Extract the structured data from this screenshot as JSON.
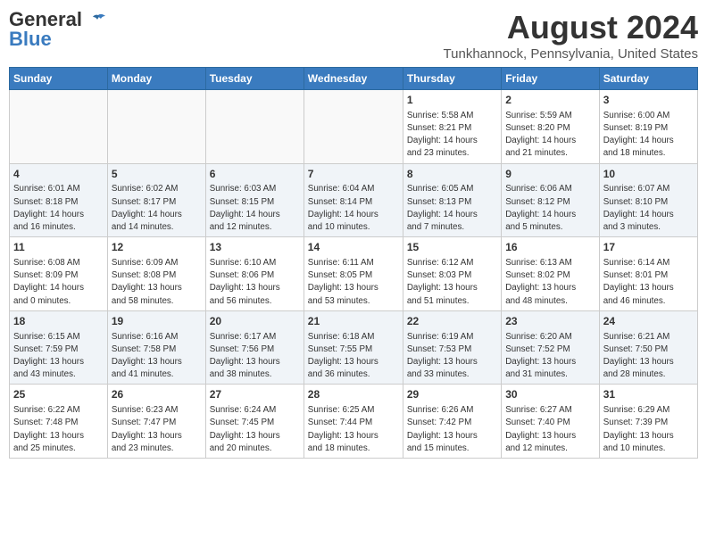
{
  "header": {
    "logo_line1": "General",
    "logo_line2": "Blue",
    "month_year": "August 2024",
    "location": "Tunkhannock, Pennsylvania, United States"
  },
  "days_of_week": [
    "Sunday",
    "Monday",
    "Tuesday",
    "Wednesday",
    "Thursday",
    "Friday",
    "Saturday"
  ],
  "weeks": [
    [
      {
        "day": "",
        "text": ""
      },
      {
        "day": "",
        "text": ""
      },
      {
        "day": "",
        "text": ""
      },
      {
        "day": "",
        "text": ""
      },
      {
        "day": "1",
        "text": "Sunrise: 5:58 AM\nSunset: 8:21 PM\nDaylight: 14 hours\nand 23 minutes."
      },
      {
        "day": "2",
        "text": "Sunrise: 5:59 AM\nSunset: 8:20 PM\nDaylight: 14 hours\nand 21 minutes."
      },
      {
        "day": "3",
        "text": "Sunrise: 6:00 AM\nSunset: 8:19 PM\nDaylight: 14 hours\nand 18 minutes."
      }
    ],
    [
      {
        "day": "4",
        "text": "Sunrise: 6:01 AM\nSunset: 8:18 PM\nDaylight: 14 hours\nand 16 minutes."
      },
      {
        "day": "5",
        "text": "Sunrise: 6:02 AM\nSunset: 8:17 PM\nDaylight: 14 hours\nand 14 minutes."
      },
      {
        "day": "6",
        "text": "Sunrise: 6:03 AM\nSunset: 8:15 PM\nDaylight: 14 hours\nand 12 minutes."
      },
      {
        "day": "7",
        "text": "Sunrise: 6:04 AM\nSunset: 8:14 PM\nDaylight: 14 hours\nand 10 minutes."
      },
      {
        "day": "8",
        "text": "Sunrise: 6:05 AM\nSunset: 8:13 PM\nDaylight: 14 hours\nand 7 minutes."
      },
      {
        "day": "9",
        "text": "Sunrise: 6:06 AM\nSunset: 8:12 PM\nDaylight: 14 hours\nand 5 minutes."
      },
      {
        "day": "10",
        "text": "Sunrise: 6:07 AM\nSunset: 8:10 PM\nDaylight: 14 hours\nand 3 minutes."
      }
    ],
    [
      {
        "day": "11",
        "text": "Sunrise: 6:08 AM\nSunset: 8:09 PM\nDaylight: 14 hours\nand 0 minutes."
      },
      {
        "day": "12",
        "text": "Sunrise: 6:09 AM\nSunset: 8:08 PM\nDaylight: 13 hours\nand 58 minutes."
      },
      {
        "day": "13",
        "text": "Sunrise: 6:10 AM\nSunset: 8:06 PM\nDaylight: 13 hours\nand 56 minutes."
      },
      {
        "day": "14",
        "text": "Sunrise: 6:11 AM\nSunset: 8:05 PM\nDaylight: 13 hours\nand 53 minutes."
      },
      {
        "day": "15",
        "text": "Sunrise: 6:12 AM\nSunset: 8:03 PM\nDaylight: 13 hours\nand 51 minutes."
      },
      {
        "day": "16",
        "text": "Sunrise: 6:13 AM\nSunset: 8:02 PM\nDaylight: 13 hours\nand 48 minutes."
      },
      {
        "day": "17",
        "text": "Sunrise: 6:14 AM\nSunset: 8:01 PM\nDaylight: 13 hours\nand 46 minutes."
      }
    ],
    [
      {
        "day": "18",
        "text": "Sunrise: 6:15 AM\nSunset: 7:59 PM\nDaylight: 13 hours\nand 43 minutes."
      },
      {
        "day": "19",
        "text": "Sunrise: 6:16 AM\nSunset: 7:58 PM\nDaylight: 13 hours\nand 41 minutes."
      },
      {
        "day": "20",
        "text": "Sunrise: 6:17 AM\nSunset: 7:56 PM\nDaylight: 13 hours\nand 38 minutes."
      },
      {
        "day": "21",
        "text": "Sunrise: 6:18 AM\nSunset: 7:55 PM\nDaylight: 13 hours\nand 36 minutes."
      },
      {
        "day": "22",
        "text": "Sunrise: 6:19 AM\nSunset: 7:53 PM\nDaylight: 13 hours\nand 33 minutes."
      },
      {
        "day": "23",
        "text": "Sunrise: 6:20 AM\nSunset: 7:52 PM\nDaylight: 13 hours\nand 31 minutes."
      },
      {
        "day": "24",
        "text": "Sunrise: 6:21 AM\nSunset: 7:50 PM\nDaylight: 13 hours\nand 28 minutes."
      }
    ],
    [
      {
        "day": "25",
        "text": "Sunrise: 6:22 AM\nSunset: 7:48 PM\nDaylight: 13 hours\nand 25 minutes."
      },
      {
        "day": "26",
        "text": "Sunrise: 6:23 AM\nSunset: 7:47 PM\nDaylight: 13 hours\nand 23 minutes."
      },
      {
        "day": "27",
        "text": "Sunrise: 6:24 AM\nSunset: 7:45 PM\nDaylight: 13 hours\nand 20 minutes."
      },
      {
        "day": "28",
        "text": "Sunrise: 6:25 AM\nSunset: 7:44 PM\nDaylight: 13 hours\nand 18 minutes."
      },
      {
        "day": "29",
        "text": "Sunrise: 6:26 AM\nSunset: 7:42 PM\nDaylight: 13 hours\nand 15 minutes."
      },
      {
        "day": "30",
        "text": "Sunrise: 6:27 AM\nSunset: 7:40 PM\nDaylight: 13 hours\nand 12 minutes."
      },
      {
        "day": "31",
        "text": "Sunrise: 6:29 AM\nSunset: 7:39 PM\nDaylight: 13 hours\nand 10 minutes."
      }
    ]
  ]
}
